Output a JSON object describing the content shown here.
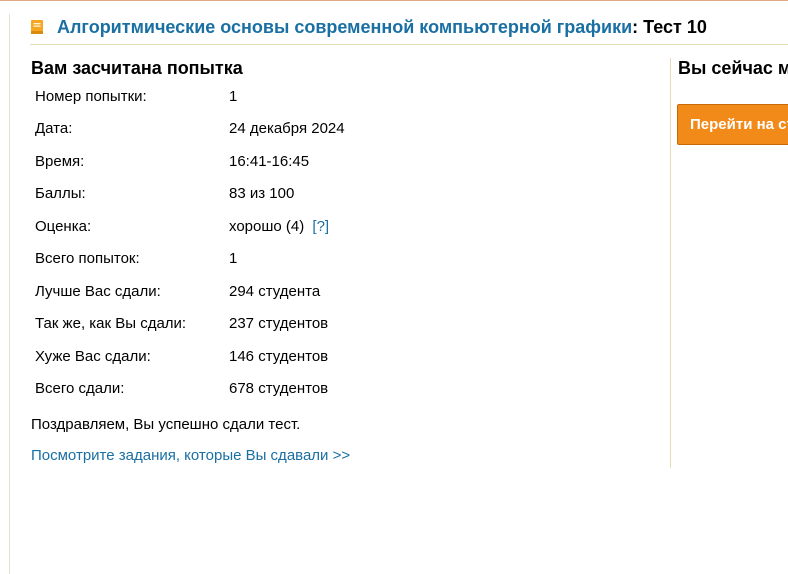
{
  "header": {
    "course_title": "Алгоритмические основы современной компьютерной графики",
    "test_name": ": Тест 10"
  },
  "result": {
    "section_title": "Вам засчитана попытка",
    "rows": [
      {
        "label": "Номер попытки:",
        "value": "1"
      },
      {
        "label": "Дата:",
        "value": "24 декабря 2024"
      },
      {
        "label": "Время:",
        "value": "16:41-16:45"
      },
      {
        "label": "Баллы:",
        "value": "83 из 100"
      },
      {
        "label": "Оценка:",
        "value": "хорошо (4)",
        "help": "[?]"
      },
      {
        "label": "Всего попыток:",
        "value": "1"
      },
      {
        "label": "Лучше Вас сдали:",
        "value": "294 студента"
      },
      {
        "label": "Так же, как Вы сдали:",
        "value": "237 студентов"
      },
      {
        "label": "Хуже Вас сдали:",
        "value": "146 студентов"
      },
      {
        "label": "Всего сдали:",
        "value": "678 студентов"
      }
    ],
    "congrats": "Поздравляем, Вы успешно сдали тест.",
    "view_link": "Посмотрите задания, которые Вы сдавали >>"
  },
  "sidebar": {
    "title": "Вы сейчас м",
    "button_label": "Перейти на ст"
  },
  "colors": {
    "link": "#1a6fa3",
    "button": "#f28a1a",
    "icon": "#f5a623"
  },
  "icons": {
    "header_icon": "book-icon"
  }
}
